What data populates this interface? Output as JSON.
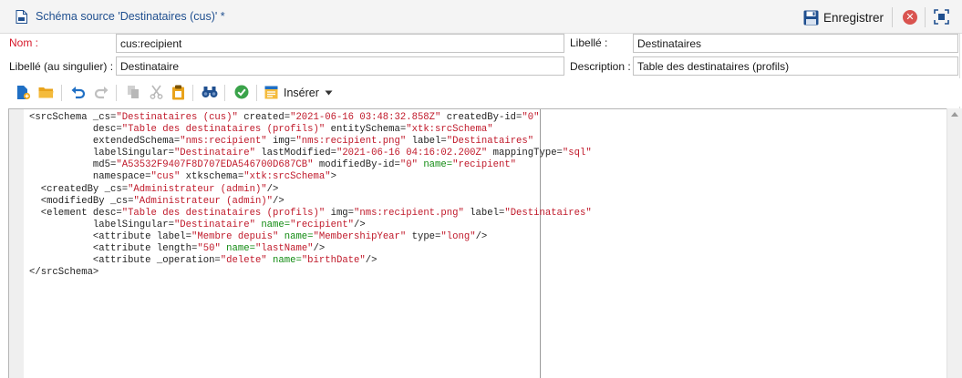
{
  "window": {
    "title": "Schéma source 'Destinataires (cus)' *",
    "save_label": "Enregistrer"
  },
  "form": {
    "name_label": "Nom :",
    "name_value": "cus:recipient",
    "label_label": "Libellé :",
    "label_value": "Destinataires",
    "singular_label": "Libellé (au singulier) :",
    "singular_value": "Destinataire",
    "description_label": "Description :",
    "description_value": "Table des destinataires (profils)"
  },
  "toolbar": {
    "insert_label": "Insérer"
  },
  "colors": {
    "accent": "#1f4f8f",
    "required": "#d6182a",
    "xml_value": "#c0192a",
    "xml_name_attr": "#108a10"
  },
  "editor": {
    "lines": [
      [
        [
          "t",
          "<srcSchema _cs="
        ],
        [
          "v",
          "\"Destinataires (cus)\""
        ],
        [
          "t",
          " created="
        ],
        [
          "v",
          "\"2021-06-16 03:48:32.858Z\""
        ],
        [
          "t",
          " createdBy-id="
        ],
        [
          "v",
          "\"0\""
        ]
      ],
      [
        [
          "t",
          "           desc="
        ],
        [
          "v",
          "\"Table des destinataires (profils)\""
        ],
        [
          "t",
          " entitySchema="
        ],
        [
          "v",
          "\"xtk:srcSchema\""
        ]
      ],
      [
        [
          "t",
          "           extendedSchema="
        ],
        [
          "v",
          "\"nms:recipient\""
        ],
        [
          "t",
          " img="
        ],
        [
          "v",
          "\"nms:recipient.png\""
        ],
        [
          "t",
          " label="
        ],
        [
          "v",
          "\"Destinataires\""
        ]
      ],
      [
        [
          "t",
          "           labelSingular="
        ],
        [
          "v",
          "\"Destinataire\""
        ],
        [
          "t",
          " lastModified="
        ],
        [
          "v",
          "\"2021-06-16 04:16:02.200Z\""
        ],
        [
          "t",
          " mappingType="
        ],
        [
          "v",
          "\"sql\""
        ]
      ],
      [
        [
          "t",
          "           md5="
        ],
        [
          "v",
          "\"A53532F9407F8D707EDA546700D687CB\""
        ],
        [
          "t",
          " modifiedBy-id="
        ],
        [
          "v",
          "\"0\""
        ],
        [
          "t",
          " "
        ],
        [
          "n",
          "name="
        ],
        [
          "v",
          "\"recipient\""
        ]
      ],
      [
        [
          "t",
          "           namespace="
        ],
        [
          "v",
          "\"cus\""
        ],
        [
          "t",
          " xtkschema="
        ],
        [
          "v",
          "\"xtk:srcSchema\""
        ],
        [
          "t",
          ">"
        ]
      ],
      [
        [
          "t",
          "  <createdBy _cs="
        ],
        [
          "v",
          "\"Administrateur (admin)\""
        ],
        [
          "t",
          "/>"
        ]
      ],
      [
        [
          "t",
          "  <modifiedBy _cs="
        ],
        [
          "v",
          "\"Administrateur (admin)\""
        ],
        [
          "t",
          "/>"
        ]
      ],
      [
        [
          "t",
          "  <element desc="
        ],
        [
          "v",
          "\"Table des destinataires (profils)\""
        ],
        [
          "t",
          " img="
        ],
        [
          "v",
          "\"nms:recipient.png\""
        ],
        [
          "t",
          " label="
        ],
        [
          "v",
          "\"Destinataires\""
        ]
      ],
      [
        [
          "t",
          "           labelSingular="
        ],
        [
          "v",
          "\"Destinataire\""
        ],
        [
          "t",
          " "
        ],
        [
          "n",
          "name="
        ],
        [
          "v",
          "\"recipient\""
        ],
        [
          "t",
          "/>"
        ]
      ],
      [
        [
          "t",
          "           <attribute label="
        ],
        [
          "v",
          "\"Membre depuis\""
        ],
        [
          "t",
          " "
        ],
        [
          "n",
          "name="
        ],
        [
          "v",
          "\"MembershipYear\""
        ],
        [
          "t",
          " type="
        ],
        [
          "v",
          "\"long\""
        ],
        [
          "t",
          "/>"
        ]
      ],
      [
        [
          "t",
          "           <attribute length="
        ],
        [
          "v",
          "\"50\""
        ],
        [
          "t",
          " "
        ],
        [
          "n",
          "name="
        ],
        [
          "v",
          "\"lastName\""
        ],
        [
          "t",
          "/>"
        ]
      ],
      [
        [
          "t",
          "           <attribute _operation="
        ],
        [
          "v",
          "\"delete\""
        ],
        [
          "t",
          " "
        ],
        [
          "n",
          "name="
        ],
        [
          "v",
          "\"birthDate\""
        ],
        [
          "t",
          "/>"
        ]
      ],
      [
        [
          "t",
          "</srcSchema>"
        ]
      ]
    ]
  }
}
